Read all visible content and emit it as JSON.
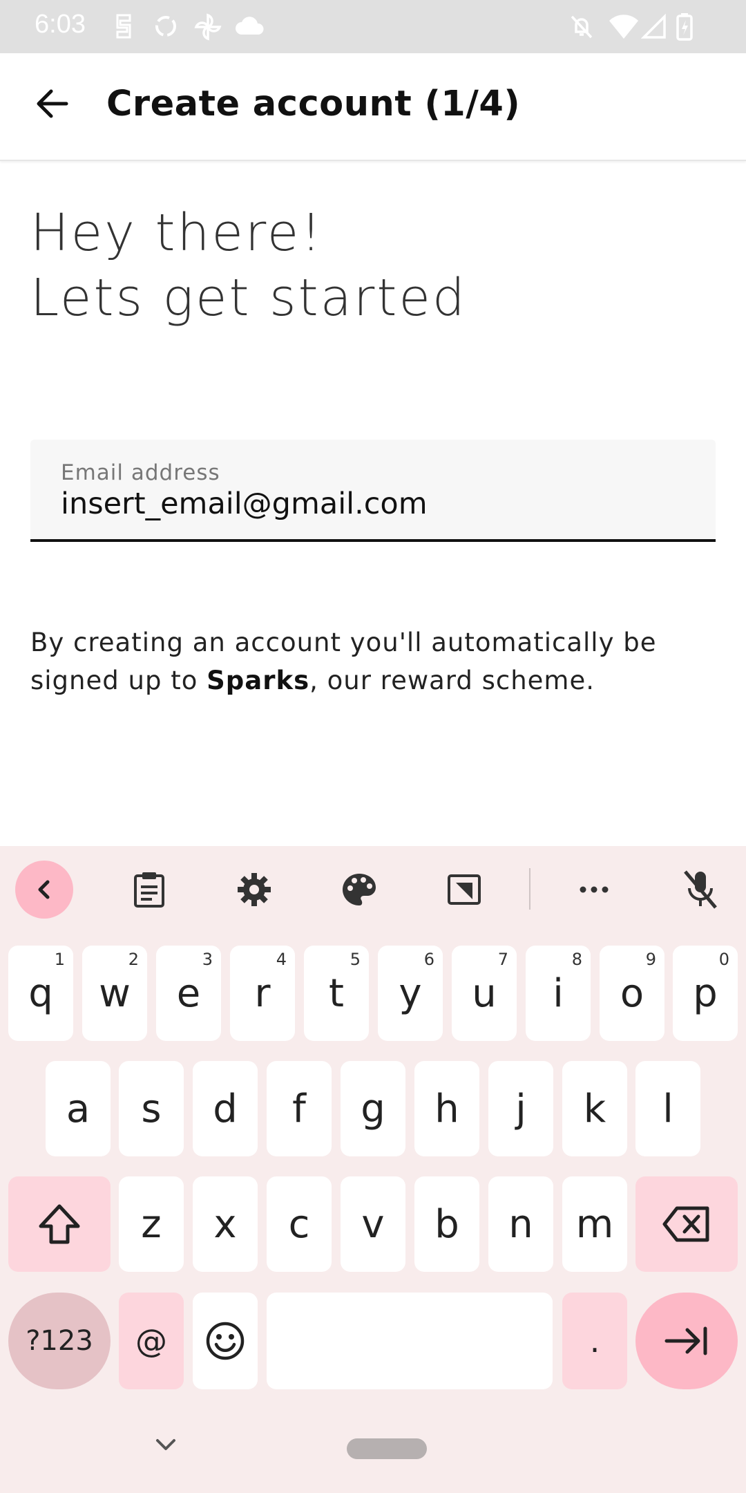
{
  "status_bar": {
    "time": "6:03",
    "left_icons": [
      "s-icon",
      "recycle-icon",
      "pinwheel-icon",
      "cloud-icon"
    ],
    "right_icons": [
      "mute-icon",
      "wifi-icon",
      "signal-icon",
      "battery-charging-icon"
    ]
  },
  "app_bar": {
    "back_icon": "arrow-back-icon",
    "title": "Create account (1/4)"
  },
  "headline": {
    "line1": "Hey there!",
    "line2": "Lets get started"
  },
  "email_field": {
    "label": "Email address",
    "value": "insert_email@gmail.com"
  },
  "info": {
    "text_before": "By creating an account you'll automatically be signed up to ",
    "brand": "Sparks",
    "text_after": ", our reward scheme."
  },
  "keyboard": {
    "toolbar": [
      "collapse-icon",
      "clipboard-icon",
      "gear-icon",
      "palette-icon",
      "resize-icon",
      "more-icon",
      "mic-off-icon"
    ],
    "row1": [
      {
        "key": "q",
        "hint": "1"
      },
      {
        "key": "w",
        "hint": "2"
      },
      {
        "key": "e",
        "hint": "3"
      },
      {
        "key": "r",
        "hint": "4"
      },
      {
        "key": "t",
        "hint": "5"
      },
      {
        "key": "y",
        "hint": "6"
      },
      {
        "key": "u",
        "hint": "7"
      },
      {
        "key": "i",
        "hint": "8"
      },
      {
        "key": "o",
        "hint": "9"
      },
      {
        "key": "p",
        "hint": "0"
      }
    ],
    "row2": [
      "a",
      "s",
      "d",
      "f",
      "g",
      "h",
      "j",
      "k",
      "l"
    ],
    "row3": [
      "z",
      "x",
      "c",
      "v",
      "b",
      "n",
      "m"
    ],
    "symbols_label": "?123",
    "at_label": "@",
    "period_label": ".",
    "colors": {
      "background": "#f8ecec",
      "pink_key": "#fdd6dd",
      "symbols_key": "#e5c2c6",
      "key": "#ffffff"
    }
  }
}
